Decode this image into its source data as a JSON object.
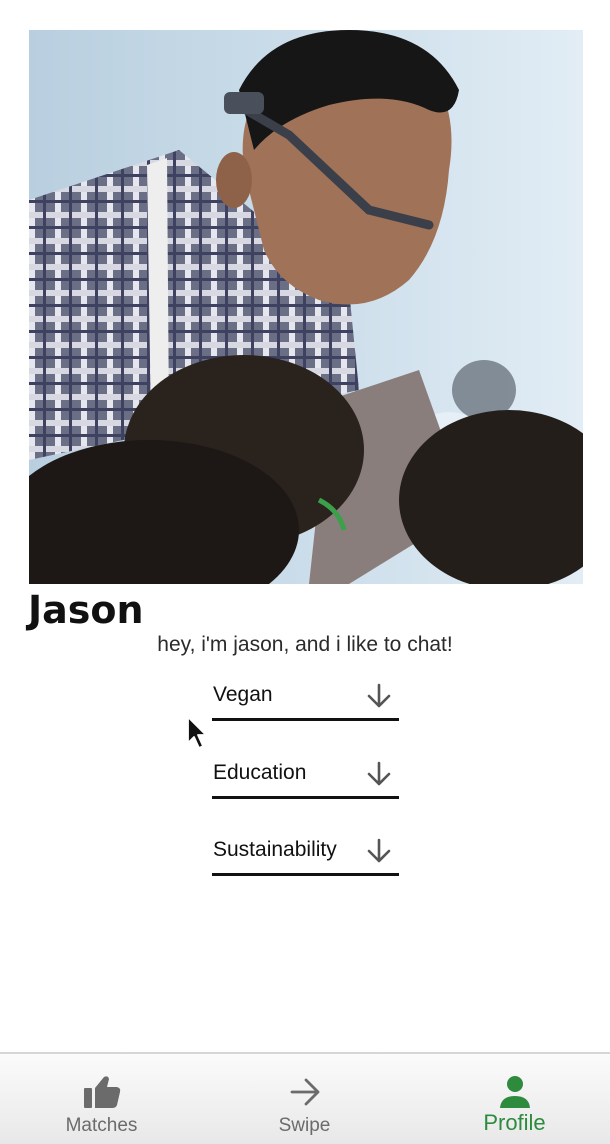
{
  "profile": {
    "name": "Jason",
    "bio": "hey, i'm jason, and i like to chat!"
  },
  "interests": [
    {
      "label": "Vegan",
      "icon": "arrow-down-icon"
    },
    {
      "label": "Education",
      "icon": "arrow-down-icon"
    },
    {
      "label": "Sustainability",
      "icon": "arrow-down-icon"
    }
  ],
  "bottom_nav": {
    "items": [
      {
        "label": "Matches",
        "icon": "thumbs-up-icon",
        "active": false
      },
      {
        "label": "Swipe",
        "icon": "arrow-right-icon",
        "active": false
      },
      {
        "label": "Profile",
        "icon": "person-icon",
        "active": true
      }
    ]
  },
  "colors": {
    "accent": "#2e8b3e",
    "inactive": "#6b6b6b",
    "text": "#111111"
  }
}
